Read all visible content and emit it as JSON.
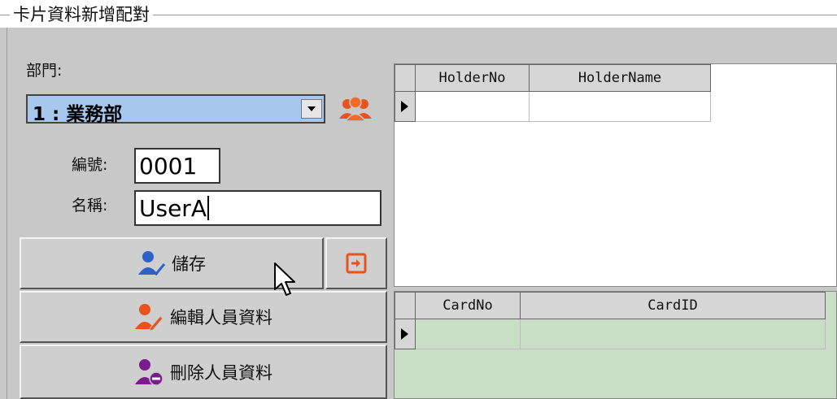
{
  "group": {
    "title": "卡片資料新增配對"
  },
  "form": {
    "dept_label": "部門:",
    "dept_selected": "1 : 業務部",
    "no_label": "編號:",
    "no_value": "0001",
    "name_label": "名稱:",
    "name_value": "UserA"
  },
  "buttons": {
    "save": "儲存",
    "edit": "編輯人員資料",
    "delete": "刪除人員資料"
  },
  "holder_grid": {
    "columns": [
      "HolderNo",
      "HolderName"
    ],
    "rows": [
      [
        "",
        ""
      ]
    ]
  },
  "card_grid": {
    "columns": [
      "CardNo",
      "CardID"
    ],
    "rows": [
      [
        "",
        ""
      ]
    ]
  },
  "colors": {
    "select_bg": "#a7c7ec",
    "user_blue": "#2f62c8",
    "user_orange": "#e8531c",
    "user_purple": "#7a1c8c",
    "card_grid_bg": "#c8dfc6"
  }
}
